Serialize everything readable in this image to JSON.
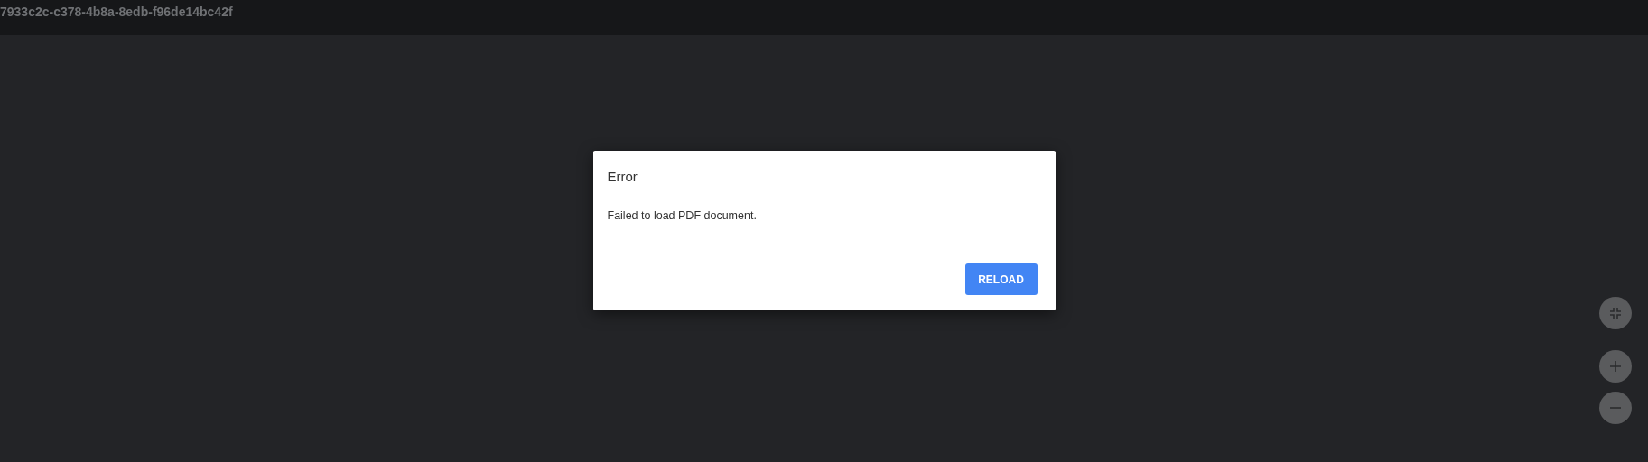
{
  "toolbar": {
    "title": "7933c2c-c378-4b8a-8edb-f96de14bc42f"
  },
  "dialog": {
    "title": "Error",
    "message": "Failed to load PDF document.",
    "button": "RELOAD"
  }
}
